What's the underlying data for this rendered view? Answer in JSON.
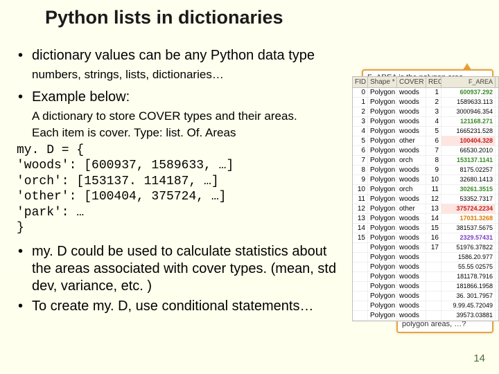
{
  "title": "Python lists in dictionaries",
  "pagenum": "14",
  "bullets": {
    "b1": "dictionary values can be any Python data type",
    "b1sub": "numbers, strings, lists, dictionaries…",
    "b2": "Example below:",
    "b2sub1": "A dictionary to store COVER types and their areas.",
    "b2sub2": "Each item is cover. Type: list. Of. Areas",
    "b3": "my. D could be used to calculate statistics about the areas associated with cover types. (mean, std dev, variance, etc. )",
    "b4": "To create my. D, use conditional statements…"
  },
  "code_lines": [
    "my. D = {",
    "'woods': [600937, 1589633, …]",
    "'orch': [153137. 114187, …]",
    "'other': [100404, 375724, …]",
    "'park': …",
    "}"
  ],
  "callout_top": "F_AREA is the polygon area",
  "callout_bot": "Want a list of wood covered polygon areas, a list of orchard covered polygon areas, …?",
  "table": {
    "headers": [
      "FID",
      "Shape *",
      "COVER",
      "RECNO",
      "F_AREA"
    ],
    "rows": [
      {
        "fid": "0",
        "shape": "Polygon",
        "cover": "woods",
        "rec": "1",
        "area": "600937.292",
        "cls": "hl-g"
      },
      {
        "fid": "1",
        "shape": "Polygon",
        "cover": "woods",
        "rec": "2",
        "area": "1589633.113",
        "cls": ""
      },
      {
        "fid": "2",
        "shape": "Polygon",
        "cover": "woods",
        "rec": "3",
        "area": "3000946.354",
        "cls": ""
      },
      {
        "fid": "3",
        "shape": "Polygon",
        "cover": "woods",
        "rec": "4",
        "area": "121168.271",
        "cls": "hl-g"
      },
      {
        "fid": "4",
        "shape": "Polygon",
        "cover": "woods",
        "rec": "5",
        "area": "1665231.528",
        "cls": ""
      },
      {
        "fid": "5",
        "shape": "Polygon",
        "cover": "other",
        "rec": "6",
        "area": "100404.328",
        "cls": "hl-r"
      },
      {
        "fid": "6",
        "shape": "Polygon",
        "cover": "woods",
        "rec": "7",
        "area": "66530.2010",
        "cls": ""
      },
      {
        "fid": "7",
        "shape": "Polygon",
        "cover": "orch",
        "rec": "8",
        "area": "153137.1141",
        "cls": "hl-g"
      },
      {
        "fid": "8",
        "shape": "Polygon",
        "cover": "woods",
        "rec": "9",
        "area": "8175.02257",
        "cls": ""
      },
      {
        "fid": "9",
        "shape": "Polygon",
        "cover": "woods",
        "rec": "10",
        "area": "32680.1413",
        "cls": ""
      },
      {
        "fid": "10",
        "shape": "Polygon",
        "cover": "orch",
        "rec": "11",
        "area": "30261.3515",
        "cls": "hl-g"
      },
      {
        "fid": "11",
        "shape": "Polygon",
        "cover": "woods",
        "rec": "12",
        "area": "53352.7317",
        "cls": ""
      },
      {
        "fid": "12",
        "shape": "Polygon",
        "cover": "other",
        "rec": "13",
        "area": "375724.2234",
        "cls": "hl-r"
      },
      {
        "fid": "13",
        "shape": "Polygon",
        "cover": "woods",
        "rec": "14",
        "area": "17031.3268",
        "cls": "hl-o"
      },
      {
        "fid": "14",
        "shape": "Polygon",
        "cover": "woods",
        "rec": "15",
        "area": "381537.5675",
        "cls": ""
      },
      {
        "fid": "15",
        "shape": "Polygon",
        "cover": "woods",
        "rec": "16",
        "area": "2329.57431",
        "cls": "hl-p"
      },
      {
        "fid": "",
        "shape": "Polygon",
        "cover": "woods",
        "rec": "17",
        "area": "51976.37822",
        "cls": ""
      },
      {
        "fid": "",
        "shape": "Polygon",
        "cover": "woods",
        "rec": "",
        "area": "1586.20.977",
        "cls": ""
      },
      {
        "fid": "",
        "shape": "Polygon",
        "cover": "woods",
        "rec": "",
        "area": "55.55 02575",
        "cls": ""
      },
      {
        "fid": "",
        "shape": "Polygon",
        "cover": "woods",
        "rec": "",
        "area": "181178.7916",
        "cls": ""
      },
      {
        "fid": "",
        "shape": "Polygon",
        "cover": "woods",
        "rec": "",
        "area": "181866.1958",
        "cls": ""
      },
      {
        "fid": "",
        "shape": "Polygon",
        "cover": "woods",
        "rec": "",
        "area": "36. 301.7957",
        "cls": ""
      },
      {
        "fid": "",
        "shape": "Polygon",
        "cover": "woods",
        "rec": "",
        "area": "9.99.45.72049",
        "cls": ""
      },
      {
        "fid": "",
        "shape": "Polygon",
        "cover": "woods",
        "rec": "",
        "area": "39573.03881",
        "cls": ""
      }
    ]
  }
}
